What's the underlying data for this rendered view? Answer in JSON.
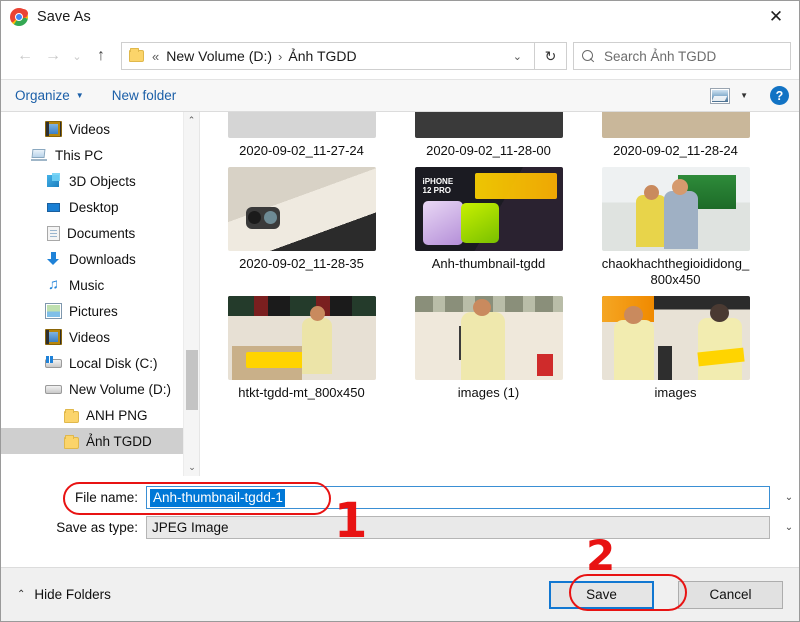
{
  "window": {
    "title": "Save As",
    "app_icon": "chrome-icon",
    "close_label": "✕"
  },
  "nav": {
    "back_icon": "←",
    "forward_icon": "→",
    "history_icon": "⌄",
    "up_icon": "↑",
    "folder_icon": "folder-icon",
    "double_chevron": "«",
    "separator": "›",
    "breadcrumb": [
      "New Volume (D:)",
      "Ảnh TGDD"
    ],
    "dropdown_icon": "⌄",
    "refresh_icon": "↻",
    "search_placeholder": "Search Ảnh TGDD"
  },
  "commandbar": {
    "organize_label": "Organize",
    "organize_caret": "▼",
    "new_folder_label": "New folder",
    "view_icon": "view-layout-icon",
    "view_caret": "▼",
    "help_label": "?"
  },
  "sidebar": {
    "items": [
      {
        "label": "Videos",
        "icon": "videos-icon",
        "indent": 1,
        "selected": false
      },
      {
        "label": "This PC",
        "icon": "this-pc-icon",
        "indent": 0,
        "selected": false
      },
      {
        "label": "3D Objects",
        "icon": "3d-objects-icon",
        "indent": 1,
        "selected": false
      },
      {
        "label": "Desktop",
        "icon": "desktop-icon",
        "indent": 1,
        "selected": false
      },
      {
        "label": "Documents",
        "icon": "documents-icon",
        "indent": 1,
        "selected": false
      },
      {
        "label": "Downloads",
        "icon": "downloads-icon",
        "indent": 1,
        "selected": false
      },
      {
        "label": "Music",
        "icon": "music-icon",
        "indent": 1,
        "selected": false
      },
      {
        "label": "Pictures",
        "icon": "pictures-icon",
        "indent": 1,
        "selected": false
      },
      {
        "label": "Videos",
        "icon": "videos-icon",
        "indent": 1,
        "selected": false
      },
      {
        "label": "Local Disk (C:)",
        "icon": "local-disk-icon",
        "indent": 1,
        "selected": false
      },
      {
        "label": "New Volume (D:)",
        "icon": "drive-icon",
        "indent": 1,
        "selected": false
      },
      {
        "label": "ANH PNG",
        "icon": "folder-icon",
        "indent": 2,
        "selected": false
      },
      {
        "label": "Ảnh TGDD",
        "icon": "folder-icon",
        "indent": 2,
        "selected": true
      }
    ],
    "scroll_up_icon": "⌃",
    "scroll_down_icon": "⌄"
  },
  "files": {
    "rows": [
      [
        {
          "name": "2020-09-02_11-27-24",
          "art": "t-desk"
        },
        {
          "name": "2020-09-02_11-28-00",
          "art": "t-blk"
        },
        {
          "name": "2020-09-02_11-28-24",
          "art": "t-wood"
        }
      ],
      [
        {
          "name": "2020-09-02_11-28-35",
          "art": "t-phone"
        },
        {
          "name": "Anh-thumbnail-tgdd",
          "art": "t-promo"
        },
        {
          "name": "chaokhachthegioididong_800x450",
          "art": "t-shop"
        }
      ],
      [
        {
          "name": "htkt-tgdd-mt_800x450",
          "art": "t-store"
        },
        {
          "name": "images (1)",
          "art": "t-store2"
        },
        {
          "name": "images",
          "art": "t-two"
        }
      ]
    ]
  },
  "form": {
    "filename_label": "File name:",
    "filename_value": "Anh-thumbnail-tgdd-1",
    "filetype_label": "Save as type:",
    "filetype_value": "JPEG Image",
    "dropdown_icon": "⌄"
  },
  "footer": {
    "hide_folders_label": "Hide Folders",
    "hide_folders_caret": "⌃",
    "save_label": "Save",
    "cancel_label": "Cancel"
  },
  "annotations": {
    "step1": "1",
    "step2": "2",
    "color": "#e81313"
  }
}
